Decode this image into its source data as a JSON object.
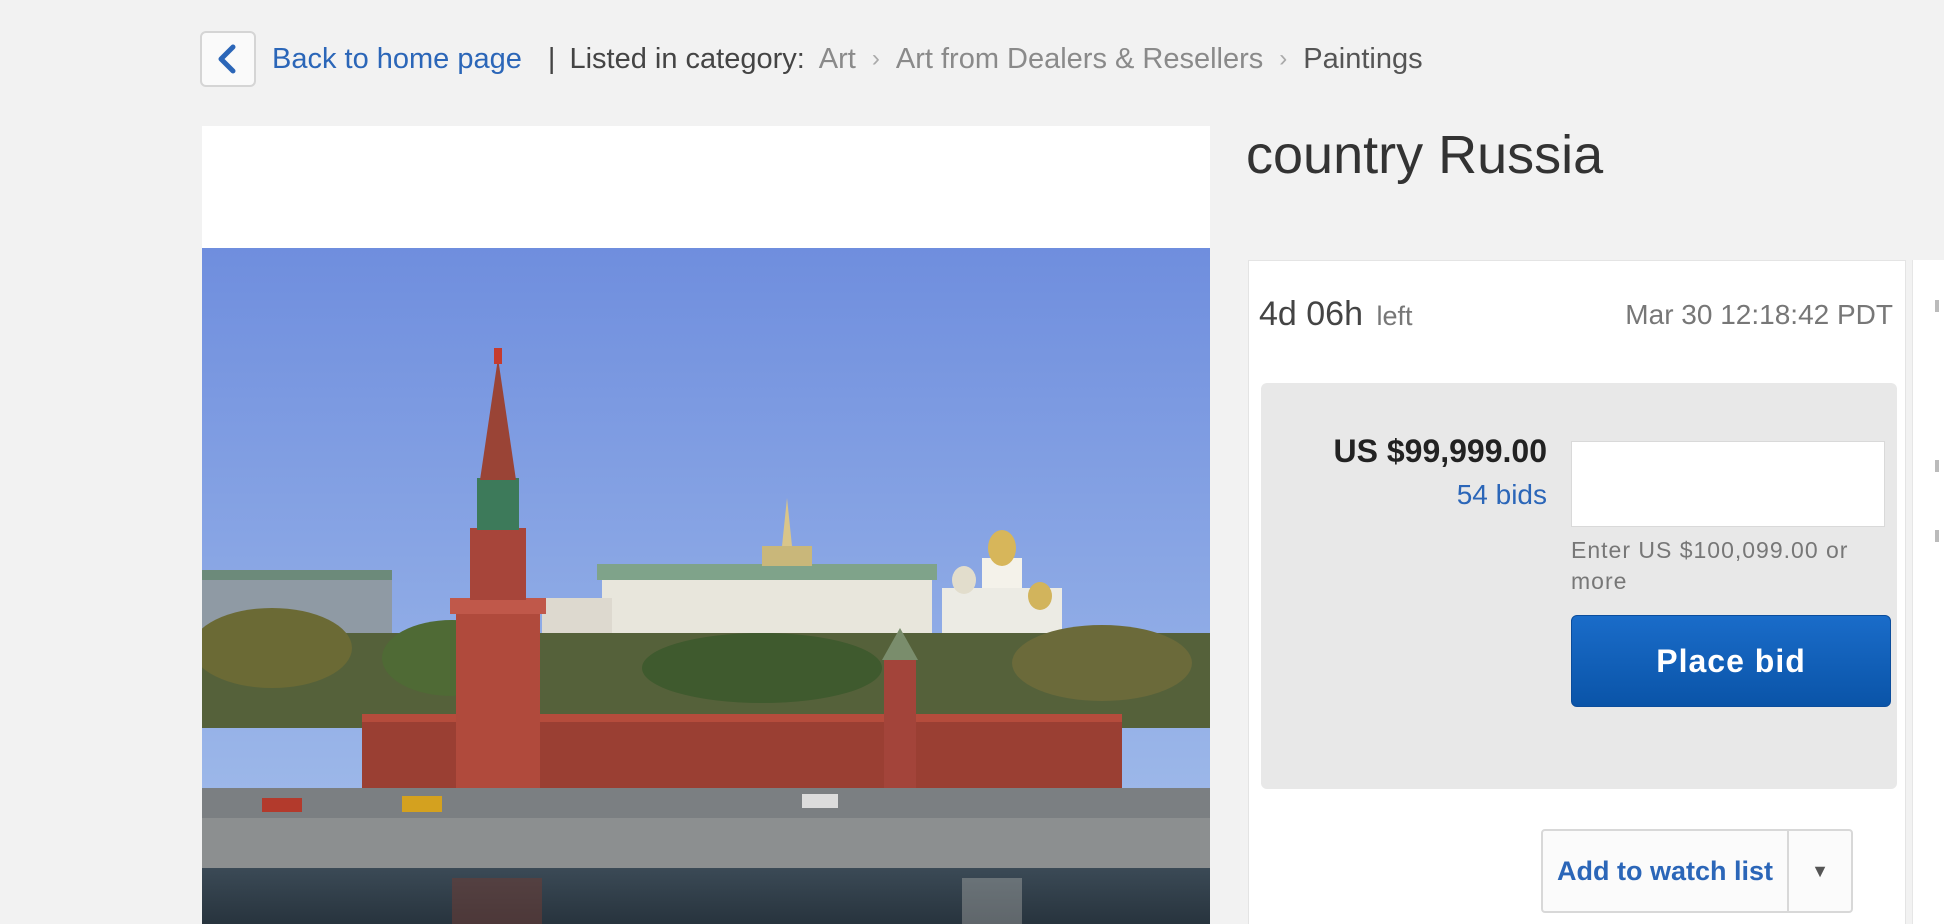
{
  "breadcrumb": {
    "back_label": "Back to home page",
    "separator": "|",
    "listed_in_label": "Listed in category:",
    "categories": [
      "Art",
      "Art from Dealers & Resellers",
      "Paintings"
    ]
  },
  "icons": {
    "back": "chevron-left-icon",
    "dropdown": "caret-down-icon",
    "crumb_separator": "chevron-right-icon"
  },
  "item": {
    "title": "country Russia",
    "image_alt": "Moscow Kremlin towers and palace beside the river"
  },
  "auction": {
    "time_left": "4d 06h",
    "time_left_suffix": "left",
    "end_time": "Mar 30 12:18:42 PDT",
    "current_price": "US $99,999.00",
    "bid_count": "54 bids",
    "bid_input_value": "",
    "bid_hint": "Enter US $100,099.00 or more",
    "place_bid_label": "Place bid",
    "watch_list_label": "Add to watch list"
  },
  "colors": {
    "link_blue": "#2b66b8",
    "primary_button": "#0a54a8",
    "page_background": "#f2f2f2",
    "bid_panel_background": "#e8e8e8"
  }
}
